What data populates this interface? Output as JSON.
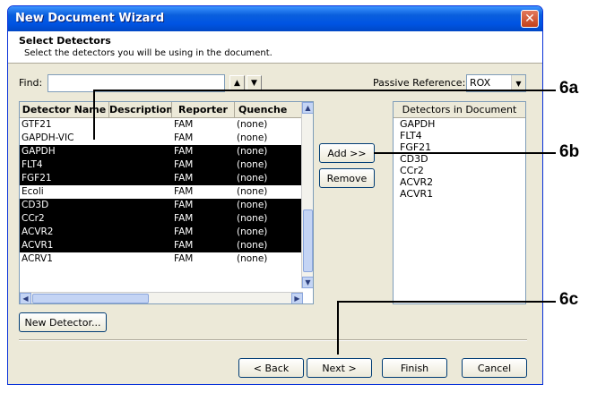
{
  "window": {
    "title": "New Document Wizard",
    "close_glyph": "✕"
  },
  "header": {
    "title": "Select Detectors",
    "subtitle": "Select the detectors you will be using in the document."
  },
  "find": {
    "label": "Find:",
    "value": "",
    "up_glyph": "▲",
    "down_glyph": "▼"
  },
  "passive_reference": {
    "label": "Passive Reference:",
    "value": "ROX",
    "dropdown_glyph": "▼"
  },
  "detectors_table": {
    "columns": [
      "Detector Name",
      "Description",
      "Reporter",
      "Quenche"
    ],
    "rows": [
      {
        "name": "GTF21",
        "description": "",
        "reporter": "FAM",
        "quencher": "(none)",
        "selected": false
      },
      {
        "name": "GAPDH-VIC",
        "description": "",
        "reporter": "FAM",
        "quencher": "(none)",
        "selected": false
      },
      {
        "name": "GAPDH",
        "description": "",
        "reporter": "FAM",
        "quencher": "(none)",
        "selected": true
      },
      {
        "name": "FLT4",
        "description": "",
        "reporter": "FAM",
        "quencher": "(none)",
        "selected": true
      },
      {
        "name": "FGF21",
        "description": "",
        "reporter": "FAM",
        "quencher": "(none)",
        "selected": true
      },
      {
        "name": "Ecoli",
        "description": "",
        "reporter": "FAM",
        "quencher": "(none)",
        "selected": false
      },
      {
        "name": "CD3D",
        "description": "",
        "reporter": "FAM",
        "quencher": "(none)",
        "selected": true
      },
      {
        "name": "CCr2",
        "description": "",
        "reporter": "FAM",
        "quencher": "(none)",
        "selected": true
      },
      {
        "name": "ACVR2",
        "description": "",
        "reporter": "FAM",
        "quencher": "(none)",
        "selected": true
      },
      {
        "name": "ACVR1",
        "description": "",
        "reporter": "FAM",
        "quencher": "(none)",
        "selected": true
      },
      {
        "name": "ACRV1",
        "description": "",
        "reporter": "FAM",
        "quencher": "(none)",
        "selected": false
      }
    ]
  },
  "buttons": {
    "add": "Add >>",
    "remove": "Remove",
    "new_detector": "New Detector...",
    "back": "< Back",
    "next": "Next >",
    "finish": "Finish",
    "cancel": "Cancel"
  },
  "detectors_in_document": {
    "header": "Detectors in Document",
    "items": [
      "GAPDH",
      "FLT4",
      "FGF21",
      "CD3D",
      "CCr2",
      "ACVR2",
      "ACVR1"
    ]
  },
  "callouts": {
    "a": "6a",
    "b": "6b",
    "c": "6c"
  },
  "colors": {
    "title_bar": "#0054e3",
    "selection": "#000000",
    "window_bg": "#ece9d8"
  }
}
